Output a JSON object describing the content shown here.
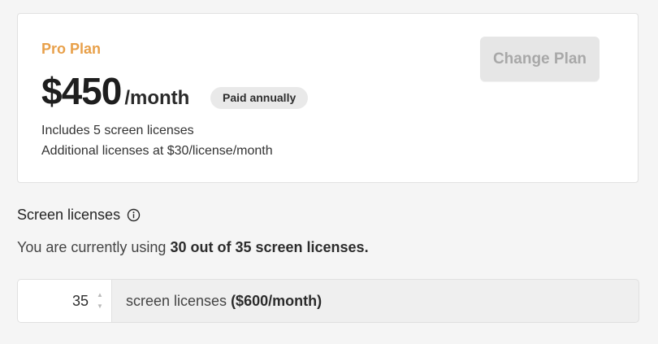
{
  "plan": {
    "name": "Pro Plan",
    "price": "$450",
    "period": "/month",
    "billing_badge": "Paid annually",
    "includes_text": "Includes 5 screen licenses",
    "additional_text": "Additional licenses at $30/license/month",
    "change_button_label": "Change Plan",
    "accent_color": "#e8a04a"
  },
  "licenses": {
    "section_title": "Screen licenses",
    "info_icon": "info-circle-icon",
    "usage_prefix": "You are currently using ",
    "usage_highlight": "30 out of 35 screen licenses.",
    "quantity": "35",
    "unit_label": "screen licenses ",
    "monthly_cost": "($600/month)",
    "spin_up_icon": "caret-up-icon",
    "spin_down_icon": "caret-down-icon"
  }
}
